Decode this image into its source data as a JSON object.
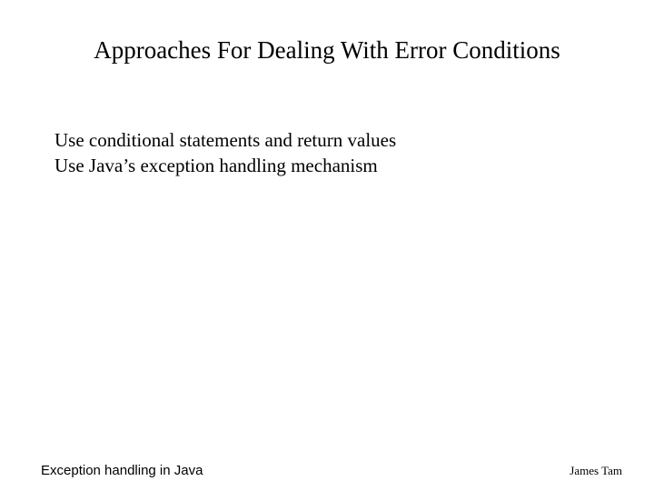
{
  "slide": {
    "title": "Approaches For Dealing With Error Conditions",
    "body": {
      "line1": "Use conditional statements and return values",
      "line2": "Use Java’s exception handling mechanism"
    },
    "footer": {
      "left": "Exception handling in Java",
      "right": "James Tam"
    }
  }
}
